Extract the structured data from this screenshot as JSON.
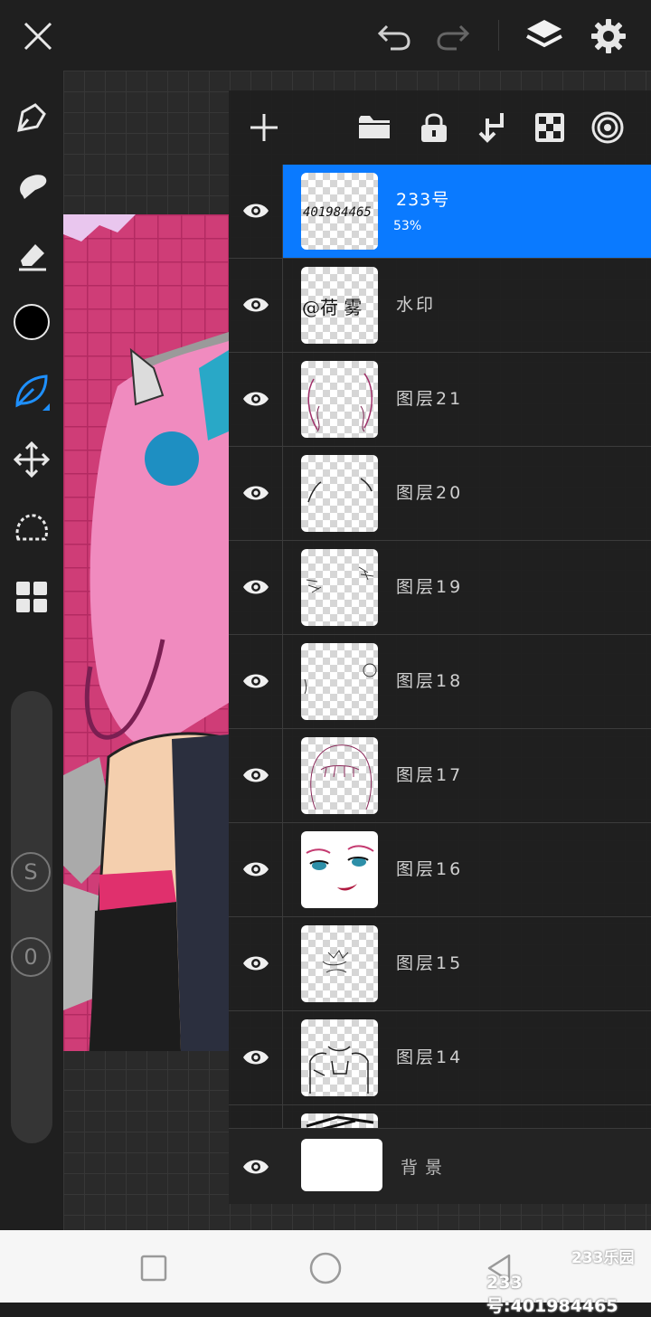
{
  "toolbar": {
    "close_icon": "close-icon",
    "undo_icon": "undo-icon",
    "redo_icon": "redo-icon",
    "layers_icon": "layers-icon",
    "settings_icon": "gear-icon"
  },
  "tools": [
    "pen-icon",
    "smudge-icon",
    "eraser-icon",
    "color-swatch",
    "brush-icon",
    "move-icon",
    "lasso-icon",
    "grid-icon"
  ],
  "current_color": "#000000",
  "accent_color": "#0a7aff",
  "side_controls": {
    "size_label": "S",
    "opacity_label": "0"
  },
  "layer_panel": {
    "tools": [
      "add-layer-icon",
      "folder-icon",
      "lock-icon",
      "merge-down-icon",
      "alpha-lock-icon",
      "blend-icon"
    ],
    "layers": [
      {
        "name": "233号",
        "opacity": "53%",
        "selected": true,
        "thumb_text": "401984465"
      },
      {
        "name": "水印",
        "thumb_text": "@荷 雾"
      },
      {
        "name": "图层21"
      },
      {
        "name": "图层20"
      },
      {
        "name": "图层19"
      },
      {
        "name": "图层18"
      },
      {
        "name": "图层17"
      },
      {
        "name": "图层16"
      },
      {
        "name": "图层15"
      },
      {
        "name": "图层14"
      }
    ],
    "background": {
      "name": "背景"
    }
  },
  "watermark": {
    "brand": "233乐园",
    "text": "233号:401984465"
  }
}
